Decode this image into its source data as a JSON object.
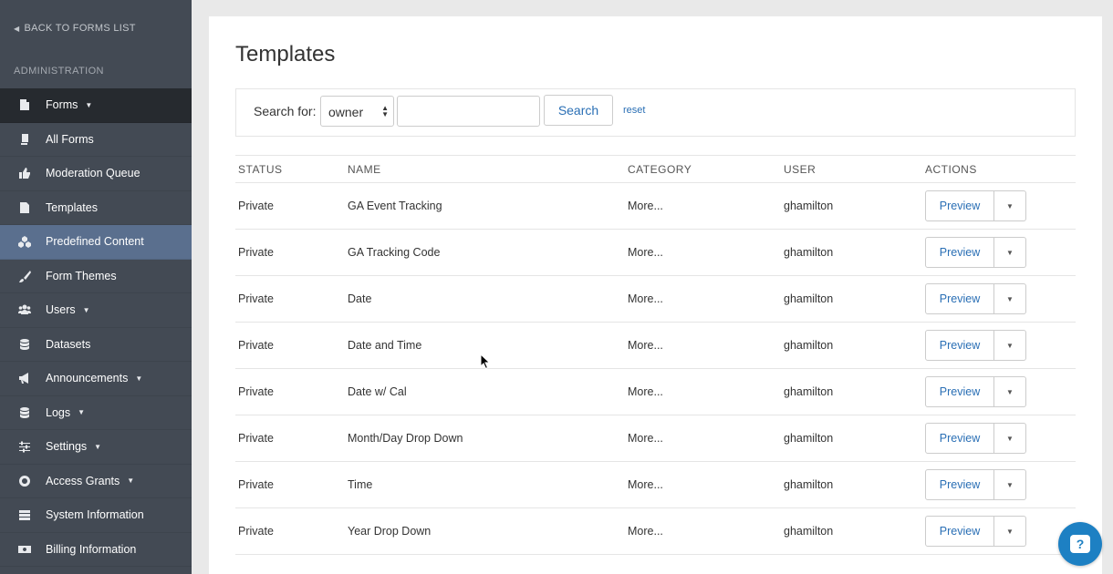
{
  "sidebar": {
    "back_label": "BACK TO FORMS LIST",
    "section_title": "ADMINISTRATION",
    "items": [
      {
        "label": "Forms",
        "icon": "forms-icon",
        "caret": true,
        "state": "dark"
      },
      {
        "label": "All Forms",
        "icon": "copy-icon",
        "caret": false,
        "state": ""
      },
      {
        "label": "Moderation Queue",
        "icon": "thumbs-up-icon",
        "caret": false,
        "state": ""
      },
      {
        "label": "Templates",
        "icon": "file-icon",
        "caret": false,
        "state": ""
      },
      {
        "label": "Predefined Content",
        "icon": "cubes-icon",
        "caret": false,
        "state": "active"
      },
      {
        "label": "Form Themes",
        "icon": "brush-icon",
        "caret": false,
        "state": ""
      },
      {
        "label": "Users",
        "icon": "users-icon",
        "caret": true,
        "state": ""
      },
      {
        "label": "Datasets",
        "icon": "database-icon",
        "caret": false,
        "state": ""
      },
      {
        "label": "Announcements",
        "icon": "bullhorn-icon",
        "caret": true,
        "state": ""
      },
      {
        "label": "Logs",
        "icon": "logs-icon",
        "caret": true,
        "state": ""
      },
      {
        "label": "Settings",
        "icon": "sliders-icon",
        "caret": true,
        "state": ""
      },
      {
        "label": "Access Grants",
        "icon": "life-ring-icon",
        "caret": true,
        "state": ""
      },
      {
        "label": "System Information",
        "icon": "server-icon",
        "caret": false,
        "state": ""
      },
      {
        "label": "Billing Information",
        "icon": "money-icon",
        "caret": false,
        "state": ""
      }
    ]
  },
  "main": {
    "title": "Templates",
    "search": {
      "label": "Search for:",
      "select_value": "owner",
      "input_value": "",
      "button_label": "Search",
      "reset_label": "reset"
    },
    "table": {
      "headers": [
        "STATUS",
        "NAME",
        "CATEGORY",
        "USER",
        "ACTIONS"
      ],
      "rows": [
        {
          "status": "Private",
          "name": "GA Event Tracking",
          "category": "More...",
          "user": "ghamilton"
        },
        {
          "status": "Private",
          "name": "GA Tracking Code",
          "category": "More...",
          "user": "ghamilton"
        },
        {
          "status": "Private",
          "name": "Date",
          "category": "More...",
          "user": "ghamilton"
        },
        {
          "status": "Private",
          "name": "Date and Time",
          "category": "More...",
          "user": "ghamilton"
        },
        {
          "status": "Private",
          "name": "Date w/ Cal",
          "category": "More...",
          "user": "ghamilton"
        },
        {
          "status": "Private",
          "name": "Month/Day Drop Down",
          "category": "More...",
          "user": "ghamilton"
        },
        {
          "status": "Private",
          "name": "Time",
          "category": "More...",
          "user": "ghamilton"
        },
        {
          "status": "Private",
          "name": "Year Drop Down",
          "category": "More...",
          "user": "ghamilton"
        }
      ],
      "preview_label": "Preview"
    }
  },
  "colors": {
    "sidebar_bg": "#434a54",
    "sidebar_dark": "#262a2f",
    "sidebar_active": "#5a6f8e",
    "link": "#2a6fb5",
    "help_bubble": "#1d80c3"
  }
}
